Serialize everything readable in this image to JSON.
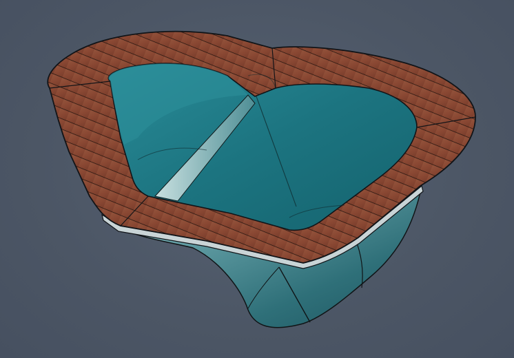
{
  "scene": {
    "subject": "heart-shaped-hot-tub-model",
    "colors": {
      "background": "#4e5868",
      "water": "#1f7a86",
      "water_dark": "#136470",
      "shell": "#2e6f78",
      "shell_light": "#8fb8bc",
      "deck_wood": "#8a4a35",
      "deck_wood_dark": "#6b3526",
      "outline": "#111418"
    }
  }
}
